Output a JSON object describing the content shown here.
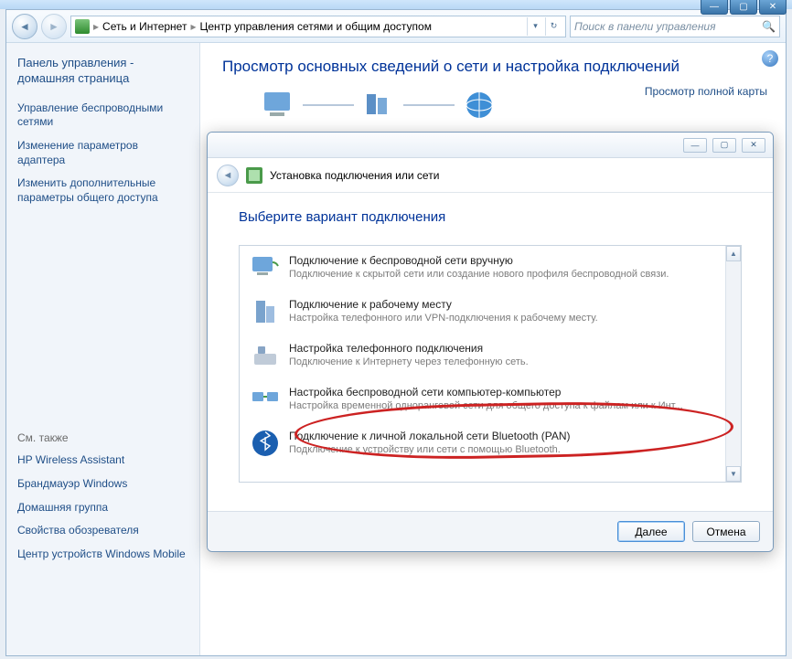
{
  "window": {
    "min": "—",
    "max": "▭",
    "close": "✕"
  },
  "toolbar": {
    "crumb1": "Сеть и Интернет",
    "crumb2": "Центр управления сетями и общим доступом",
    "search_placeholder": "Поиск в панели управления"
  },
  "sidebar": {
    "home_title": "Панель управления - домашняя страница",
    "links": [
      "Управление беспроводными сетями",
      "Изменение параметров адаптера",
      "Изменить дополнительные параметры общего доступа"
    ],
    "see_also": "См. также",
    "also_links": [
      "HP Wireless Assistant",
      "Брандмауэр Windows",
      "Домашняя группа",
      "Свойства обозревателя",
      "Центр устройств Windows Mobile"
    ]
  },
  "main": {
    "title": "Просмотр основных сведений о сети и настройка подключений",
    "map_link": "Просмотр полной карты"
  },
  "wizard": {
    "header": "Установка подключения или сети",
    "prompt": "Выберите вариант подключения",
    "options": [
      {
        "title": "Подключение к беспроводной сети вручную",
        "sub": "Подключение к скрытой сети или создание нового профиля беспроводной связи."
      },
      {
        "title": "Подключение к рабочему месту",
        "sub": "Настройка телефонного или VPN-подключения к рабочему месту."
      },
      {
        "title": "Настройка телефонного подключения",
        "sub": "Подключение к Интернету через телефонную сеть."
      },
      {
        "title": "Настройка беспроводной сети компьютер-компьютер",
        "sub": "Настройка временной одноранговой сети для общего доступа к файлам или к Инт..."
      },
      {
        "title": "Подключение к личной локальной сети Bluetooth (PAN)",
        "sub": "Подключение к устройству или сети с помощью Bluetooth."
      }
    ],
    "next": "Далее",
    "cancel": "Отмена"
  }
}
